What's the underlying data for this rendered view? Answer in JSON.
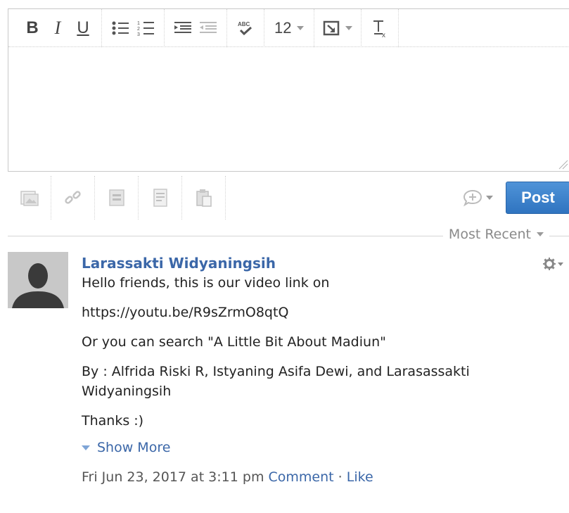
{
  "toolbar": {
    "bold": "B",
    "italic": "I",
    "underline": "U",
    "font_size": "12"
  },
  "actions": {
    "post_label": "Post"
  },
  "sort": {
    "label": "Most Recent"
  },
  "comment": {
    "author": "Larassakti Widyaningsih",
    "paragraphs": [
      "Hello friends, this is our video link on",
      "https://youtu.be/R9sZrmO8qtQ",
      "Or you can search \"A Little Bit About Madiun\"",
      "By : Alfrida Riski R, Istyaning Asifa Dewi, and Larasassakti Widyaningsih",
      "Thanks :)"
    ],
    "show_more": "Show More",
    "timestamp": "Fri Jun 23, 2017 at 3:11 pm",
    "comment_link": "Comment",
    "separator": "·",
    "like_link": "Like"
  },
  "colors": {
    "link": "#3b67a8",
    "post_button": "#3a80cc"
  }
}
